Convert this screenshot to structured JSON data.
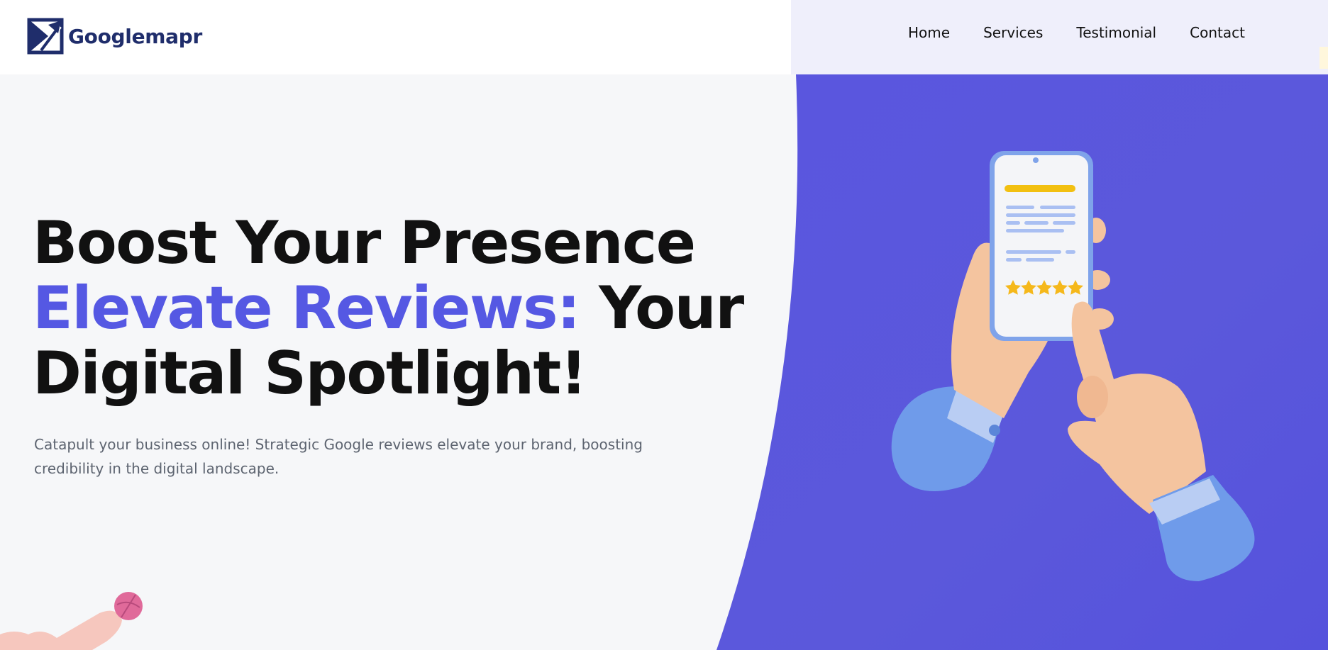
{
  "brand": {
    "name": "Googlemapr",
    "icon": "arrow-logo-icon"
  },
  "nav": {
    "items": [
      {
        "label": "Home"
      },
      {
        "label": "Services"
      },
      {
        "label": "Testimonial"
      },
      {
        "label": "Contact"
      }
    ]
  },
  "hero": {
    "headline_line1": "Boost Your Presence",
    "headline_accent": "Elevate Reviews:",
    "headline_line2_rest": " Your",
    "headline_line3": "Digital Spotlight!",
    "subtext": "Catapult your business online! Strategic Google reviews elevate your brand, boosting credibility in the digital landscape.",
    "illustration": "hands-phone-review-illustration",
    "phone_rating_stars": 5
  },
  "colors": {
    "accent": "#5558e3",
    "panel": "#5757dd",
    "brand_text": "#1f2d6b",
    "star": "#f5b81b"
  }
}
